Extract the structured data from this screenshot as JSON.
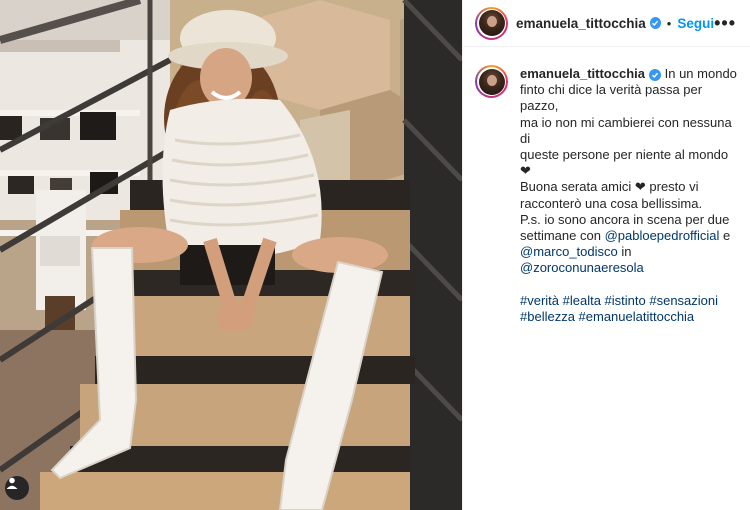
{
  "post": {
    "username": "emanuela_tittocchia",
    "follow_label": "Segui",
    "more_label": "•••",
    "verified_icon": "verified-badge-icon",
    "caption": {
      "lines": [
        "In un mondo",
        "finto chi dice la verità passa per pazzo,",
        "ma io non mi cambierei con nessuna di",
        "queste persone per niente al mondo ❤",
        "Buona serata amici ❤ presto vi",
        "racconterò una cosa bellissima.",
        "P.s. io sono ancora in scena per due",
        "settimane con"
      ],
      "mention_1": "@pabloepedrofficial",
      "after_mention_1": " e",
      "mention_2": "@marco_todisco",
      "after_mention_2": " in",
      "mention_3": "@zoroconunaeresola",
      "hashtags_line_1": "#verità #lealta #istinto #sensazioni",
      "hashtags_line_2": "#bellezza #emanuelatittocchia"
    }
  },
  "colors": {
    "link": "#00376b",
    "follow": "#0095f6",
    "verified": "#3897f0"
  },
  "icons": {
    "tag": "user-tag-icon",
    "more": "more-options-icon"
  }
}
